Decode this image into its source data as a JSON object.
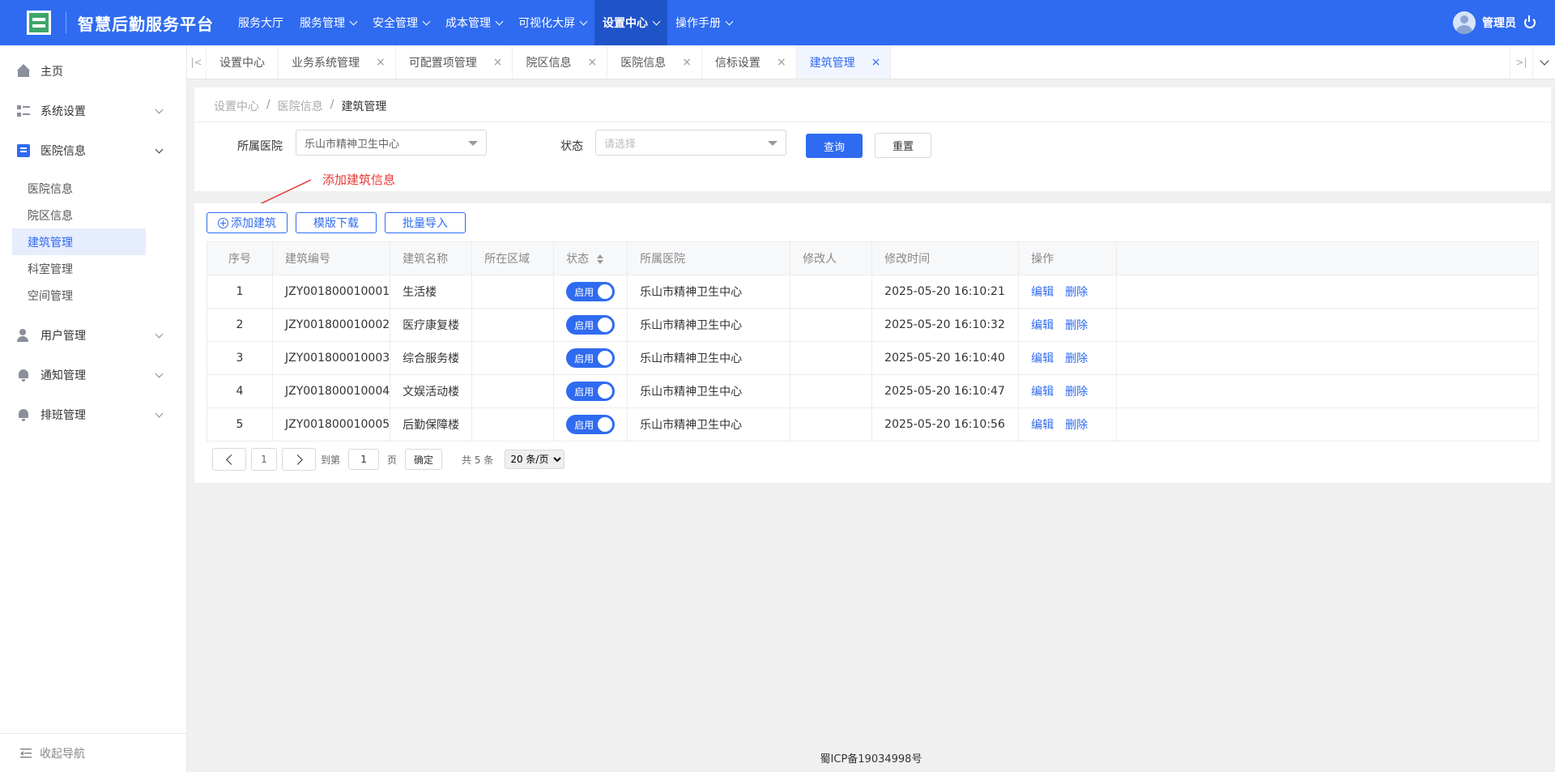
{
  "header": {
    "app_title": "智慧后勤服务平台",
    "nav": [
      {
        "label": "服务大厅",
        "has_dropdown": false,
        "active": false
      },
      {
        "label": "服务管理",
        "has_dropdown": true,
        "active": false
      },
      {
        "label": "安全管理",
        "has_dropdown": true,
        "active": false
      },
      {
        "label": "成本管理",
        "has_dropdown": true,
        "active": false
      },
      {
        "label": "可视化大屏",
        "has_dropdown": true,
        "active": false
      },
      {
        "label": "设置中心",
        "has_dropdown": true,
        "active": true
      },
      {
        "label": "操作手册",
        "has_dropdown": true,
        "active": false
      }
    ],
    "user_name": "管理员"
  },
  "sidebar": {
    "home": "主页",
    "system_settings": "系统设置",
    "hospital_info": "医院信息",
    "sub_items": [
      "医院信息",
      "院区信息",
      "建筑管理",
      "科室管理",
      "空间管理"
    ],
    "user_mgmt": "用户管理",
    "notice_mgmt": "通知管理",
    "schedule_mgmt": "排班管理",
    "collapse": "收起导航"
  },
  "tabs": [
    {
      "label": "设置中心",
      "closable": false
    },
    {
      "label": "业务系统管理",
      "closable": true
    },
    {
      "label": "可配置项管理",
      "closable": true
    },
    {
      "label": "院区信息",
      "closable": true
    },
    {
      "label": "医院信息",
      "closable": true
    },
    {
      "label": "信标设置",
      "closable": true
    },
    {
      "label": "建筑管理",
      "closable": true,
      "active": true
    }
  ],
  "breadcrumb": {
    "level1": "设置中心",
    "level2": "医院信息",
    "current": "建筑管理"
  },
  "filter": {
    "hospital_label": "所属医院",
    "hospital_value": "乐山市精神卫生中心",
    "status_label": "状态",
    "status_placeholder": "请选择",
    "query": "查询",
    "reset": "重置"
  },
  "annotation": "添加建筑信息",
  "toolbar": {
    "add": "添加建筑",
    "template": "模版下载",
    "import": "批量导入"
  },
  "table": {
    "headers": [
      "序号",
      "建筑编号",
      "建筑名称",
      "所在区域",
      "状态",
      "所属医院",
      "修改人",
      "修改时间",
      "操作"
    ],
    "rows": [
      {
        "idx": "1",
        "code": "JZY001800010001",
        "name": "生活楼",
        "area": "",
        "status": "启用",
        "hospital": "乐山市精神卫生中心",
        "modifier": "",
        "time": "2025-05-20 16:10:21"
      },
      {
        "idx": "2",
        "code": "JZY001800010002",
        "name": "医疗康复楼",
        "area": "",
        "status": "启用",
        "hospital": "乐山市精神卫生中心",
        "modifier": "",
        "time": "2025-05-20 16:10:32"
      },
      {
        "idx": "3",
        "code": "JZY001800010003",
        "name": "综合服务楼",
        "area": "",
        "status": "启用",
        "hospital": "乐山市精神卫生中心",
        "modifier": "",
        "time": "2025-05-20 16:10:40"
      },
      {
        "idx": "4",
        "code": "JZY001800010004",
        "name": "文娱活动楼",
        "area": "",
        "status": "启用",
        "hospital": "乐山市精神卫生中心",
        "modifier": "",
        "time": "2025-05-20 16:10:47"
      },
      {
        "idx": "5",
        "code": "JZY001800010005",
        "name": "后勤保障楼",
        "area": "",
        "status": "启用",
        "hospital": "乐山市精神卫生中心",
        "modifier": "",
        "time": "2025-05-20 16:10:56"
      }
    ],
    "edit": "编辑",
    "delete": "删除"
  },
  "pager": {
    "current_page": "1",
    "goto_label": "到第",
    "page_unit": "页",
    "goto_value": "1",
    "confirm": "确定",
    "total": "共 5 条",
    "page_size": "20 条/页"
  },
  "footer": "蜀ICP备19034998号",
  "colors": {
    "primary": "#2f6bf0",
    "annotation": "#e53935"
  }
}
